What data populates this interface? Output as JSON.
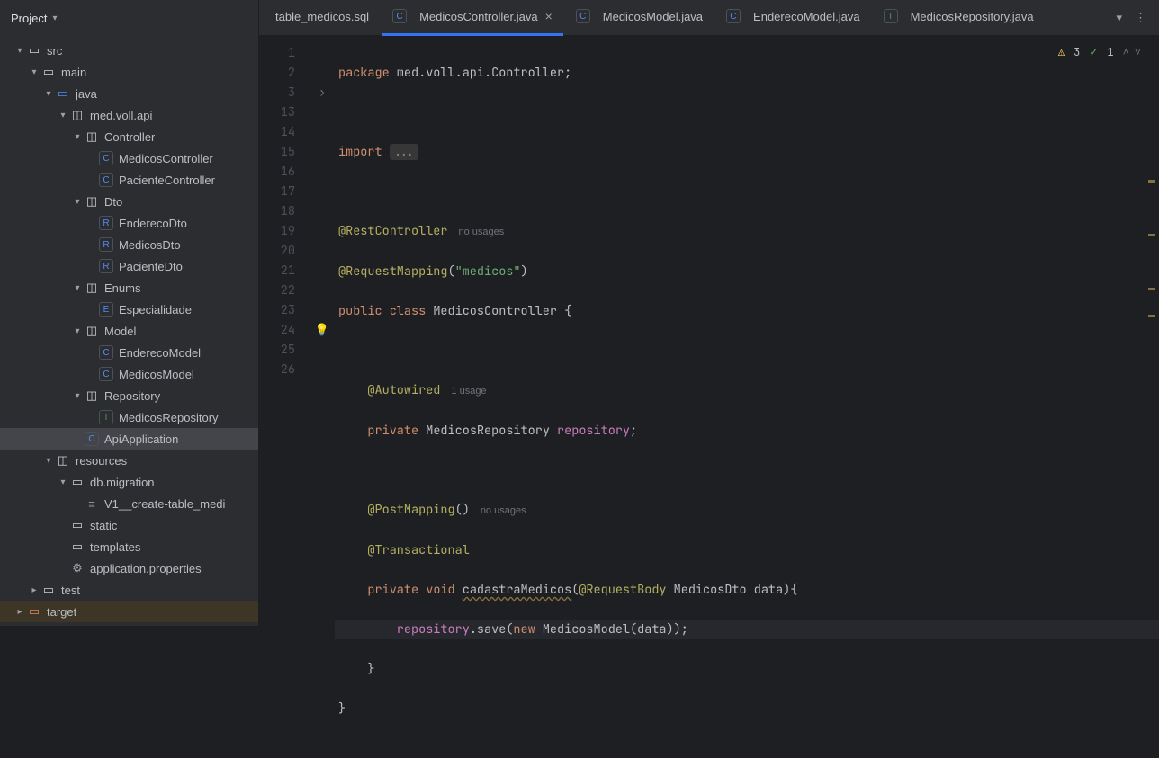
{
  "sidebar_title": "Project",
  "tree": {
    "src": "src",
    "main": "main",
    "java": "java",
    "pkg": "med.voll.api",
    "controller": "Controller",
    "medicosController": "MedicosController",
    "pacienteController": "PacienteController",
    "dto": "Dto",
    "enderecoDto": "EnderecoDto",
    "medicosDto": "MedicosDto",
    "pacienteDto": "PacienteDto",
    "enums": "Enums",
    "especialidade": "Especialidade",
    "model": "Model",
    "enderecoModel": "EnderecoModel",
    "medicosModel": "MedicosModel",
    "repository": "Repository",
    "medicosRepository": "MedicosRepository",
    "apiApplication": "ApiApplication",
    "resources": "resources",
    "dbmigration": "db.migration",
    "v1": "V1__create-table_medi",
    "static": "static",
    "templates": "templates",
    "appprops": "application.properties",
    "test": "test",
    "target": "target"
  },
  "tabs": {
    "t0": "table_medicos.sql",
    "t1": "MedicosController.java",
    "t2": "MedicosModel.java",
    "t3": "EnderecoModel.java",
    "t4": "MedicosRepository.java"
  },
  "inspections": {
    "warnings": "3",
    "checks": "1"
  },
  "lines": [
    "1",
    "2",
    "3",
    "",
    "13",
    "14",
    "15",
    "16",
    "17",
    "18",
    "19",
    "20",
    "21",
    "22",
    "23",
    "24",
    "25",
    "26"
  ],
  "code": {
    "l1_a": "package",
    "l1_b": " med.voll.api.Controller;",
    "l3_a": "import ",
    "l3_b": "...",
    "l5_a": "@RestController",
    "l5_hint": "no usages",
    "l6_a": "@RequestMapping",
    "l6_b": "(",
    "l6_c": "\"medicos\"",
    "l6_d": ")",
    "l7_a": "public ",
    "l7_b": "class ",
    "l7_c": "MedicosController ",
    "l7_d": "{",
    "l9_a": "    ",
    "l9_b": "@Autowired",
    "l9_hint": "1 usage",
    "l10_a": "    ",
    "l10_b": "private ",
    "l10_c": "MedicosRepository ",
    "l10_d": "repository",
    "l10_e": ";",
    "l12_a": "    ",
    "l12_b": "@PostMapping",
    "l12_c": "()",
    "l12_hint": "no usages",
    "l13_a": "    ",
    "l13_b": "@Transactional",
    "l14_a": "    ",
    "l14_b": "private ",
    "l14_c": "void ",
    "l14_d": "cadastraMedicos",
    "l14_e": "(",
    "l14_f": "@RequestBody",
    "l14_g": " MedicosDto data){",
    "l15_a": "        ",
    "l15_b": "repository",
    "l15_c": ".save(",
    "l15_d": "new ",
    "l15_e": "MedicosModel(data));",
    "l16_a": "    }",
    "l17_a": "}"
  }
}
